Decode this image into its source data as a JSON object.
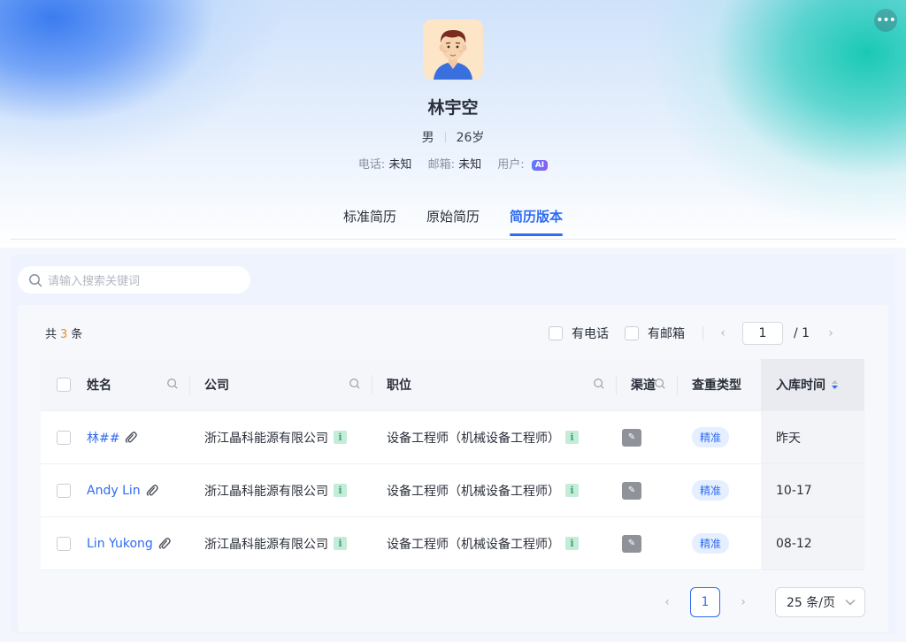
{
  "profile": {
    "name": "林宇空",
    "gender": "男",
    "age": "26岁",
    "phone_label": "电话:",
    "phone_value": "未知",
    "email_label": "邮箱:",
    "email_value": "未知",
    "user_label": "用户:",
    "user_badge": "AI"
  },
  "tabs": [
    {
      "label": "标准简历",
      "active": false
    },
    {
      "label": "原始简历",
      "active": false
    },
    {
      "label": "简历版本",
      "active": true
    }
  ],
  "search": {
    "placeholder": "请输入搜索关键词"
  },
  "summary": {
    "prefix": "共",
    "count": "3",
    "suffix": "条"
  },
  "filters": {
    "has_phone": "有电话",
    "has_email": "有邮箱"
  },
  "pager_top": {
    "current": "1",
    "total": "/ 1"
  },
  "table": {
    "columns": {
      "name": "姓名",
      "company": "公司",
      "position": "职位",
      "channel": "渠道",
      "dup_type": "查重类型",
      "time": "入库时间"
    },
    "rows": [
      {
        "name": "林##",
        "company": "浙江晶科能源有限公司",
        "position": "设备工程师（机械设备工程师）",
        "dup_type": "精准",
        "time": "昨天"
      },
      {
        "name": "Andy Lin",
        "company": "浙江晶科能源有限公司",
        "position": "设备工程师（机械设备工程师）",
        "dup_type": "精准",
        "time": "10-17"
      },
      {
        "name": "Lin Yukong",
        "company": "浙江晶科能源有限公司",
        "position": "设备工程师（机械设备工程师）",
        "dup_type": "精准",
        "time": "08-12"
      }
    ]
  },
  "pager_bottom": {
    "current": "1",
    "page_size": "25 条/页"
  },
  "icons": {
    "more": "more-icon",
    "search": "search-icon",
    "attachment": "paperclip-icon",
    "info": "info-icon",
    "channel": "channel-icon",
    "sort": "sort-icon"
  },
  "colors": {
    "accent": "#2f6cf0",
    "count": "#f08c1c",
    "info": "#3ba474"
  }
}
